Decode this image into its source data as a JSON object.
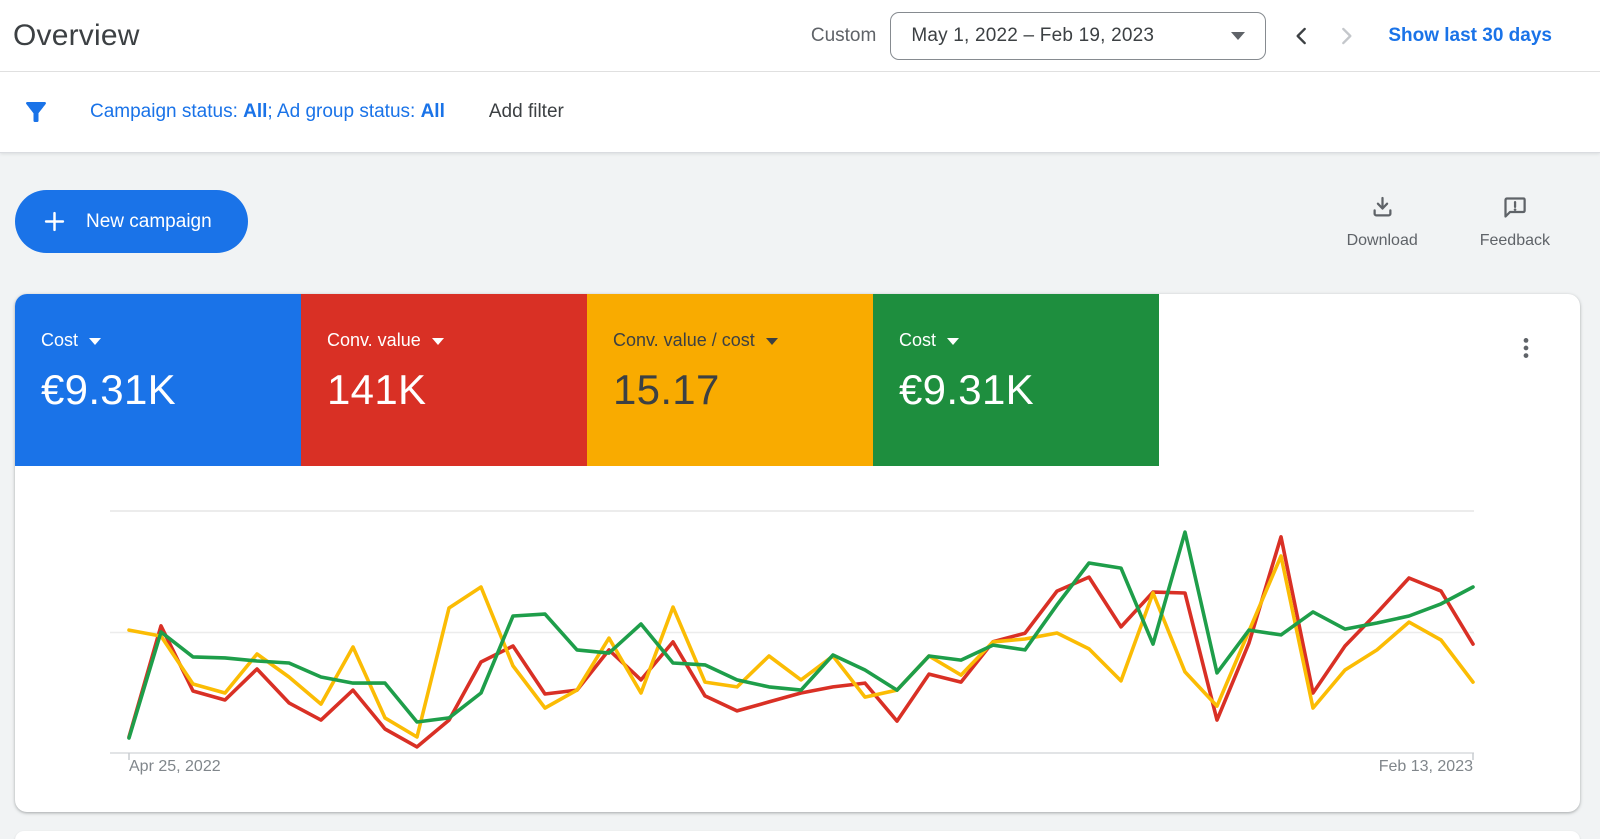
{
  "header": {
    "title": "Overview",
    "range_type": "Custom",
    "date_range": "May 1, 2022 – Feb 19, 2023",
    "show_last_link": "Show last 30 days"
  },
  "filters": {
    "campaign_status_label": "Campaign status: ",
    "campaign_status_value": "All",
    "ad_group_status_label": "; Ad group status: ",
    "ad_group_status_value": "All",
    "add_filter": "Add filter"
  },
  "actions": {
    "new_campaign": "New campaign",
    "download": "Download",
    "feedback": "Feedback"
  },
  "colors": {
    "accent_blue": "#1a73e8",
    "red": "#d93025",
    "yellow": "#f9ab00",
    "green": "#1e8e3e",
    "icon_gray": "#5f6368",
    "axis_text": "#80868b"
  },
  "scorecards": [
    {
      "metric": "Cost",
      "value": "€9.31K",
      "bg": "#1a73e8",
      "fg": "#ffffff"
    },
    {
      "metric": "Conv. value",
      "value": "141K",
      "bg": "#d93025",
      "fg": "#ffffff"
    },
    {
      "metric": "Conv. value / cost",
      "value": "15.17",
      "bg": "#f9ab00",
      "fg": "#3c4043"
    },
    {
      "metric": "Cost",
      "value": "€9.31K",
      "bg": "#1e8e3e",
      "fg": "#ffffff"
    }
  ],
  "chart_data": {
    "type": "line",
    "title": "",
    "x_axis": {
      "start_label": "Apr 25, 2022",
      "end_label": "Feb 13, 2023",
      "unit": "week",
      "points": 43
    },
    "y_axis": {
      "note": "series independently normalized; values are percent of plot height above baseline",
      "range": [
        0,
        100
      ]
    },
    "grid": {
      "horizontal_lines": 3,
      "legend": "none"
    },
    "series": [
      {
        "name": "Conv. value",
        "color": "#d93025",
        "values": [
          6.6,
          52.5,
          25.6,
          21.9,
          34.7,
          20.7,
          13.6,
          26.0,
          9.9,
          2.5,
          13.6,
          37.6,
          44.2,
          24.4,
          26.0,
          42.6,
          30.2,
          45.9,
          23.6,
          17.4,
          21.1,
          24.8,
          27.3,
          28.9,
          13.2,
          32.6,
          29.3,
          46.0,
          49.5,
          66.9,
          72.7,
          52.1,
          66.5,
          66.1,
          13.6,
          45.5,
          89.3,
          24.8,
          44.2,
          57.9,
          72.3,
          66.9,
          45.0
        ]
      },
      {
        "name": "Conv. value / cost",
        "color": "#fbbc04",
        "values": [
          50.8,
          48.3,
          28.5,
          24.8,
          40.9,
          31.4,
          20.2,
          43.8,
          14.5,
          6.6,
          59.9,
          68.6,
          36.0,
          18.6,
          26.0,
          47.5,
          24.8,
          60.3,
          29.3,
          27.3,
          40.1,
          30.2,
          40.1,
          23.1,
          26.0,
          40.1,
          32.2,
          45.9,
          47.1,
          49.6,
          43.0,
          29.8,
          66.1,
          33.5,
          19.4,
          50.4,
          81.4,
          18.6,
          34.3,
          42.6,
          54.1,
          46.7,
          29.3
        ]
      },
      {
        "name": "Cost",
        "color": "#1e9e4a",
        "values": [
          6.2,
          50.0,
          39.7,
          39.3,
          38.0,
          37.2,
          31.4,
          28.9,
          28.9,
          12.8,
          14.5,
          24.8,
          56.6,
          57.4,
          42.6,
          41.3,
          53.3,
          37.2,
          36.4,
          30.2,
          27.3,
          26.0,
          40.5,
          34.3,
          26.0,
          40.1,
          38.4,
          44.6,
          42.6,
          61.2,
          78.5,
          76.4,
          45.0,
          91.3,
          33.1,
          50.8,
          48.8,
          58.3,
          51.2,
          53.7,
          56.6,
          61.6,
          68.6
        ]
      }
    ]
  }
}
